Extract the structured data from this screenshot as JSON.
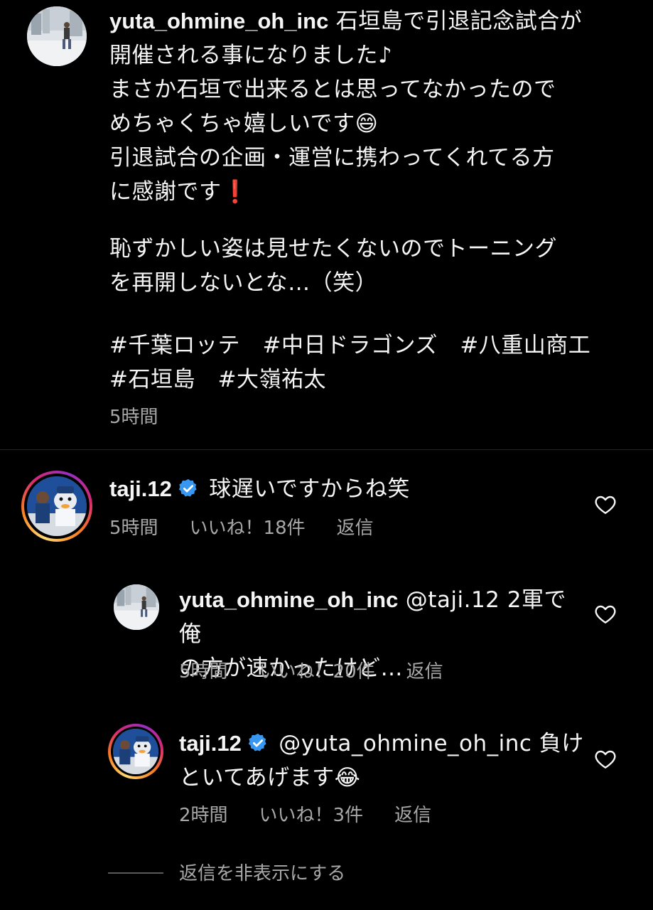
{
  "caption": {
    "username": "yuta_ohmine_oh_inc",
    "line1": "石垣島で引退記念試合が",
    "line2": "開催される事になりました♪",
    "line3": "まさか石垣で出来るとは思ってなかったので",
    "line4": "めちゃくちゃ嬉しいです😄",
    "line5": "引退試合の企画・運営に携わってくれてる方",
    "line6": "に感謝です❗",
    "line7": "恥ずかしい姿は見せたくないのでトーニング",
    "line8": "を再開しないとな…（笑）",
    "hashtags_line1": "#千葉ロッテ　#中日ドラゴンズ　#八重山商工",
    "hashtags_line2": "#石垣島　#大嶺祐太",
    "time": "5時間"
  },
  "comments": [
    {
      "username": "taji.12",
      "text": "球遅いですからね笑",
      "time": "5時間",
      "likes": "いいね！18件",
      "reply": "返信"
    }
  ],
  "replies": [
    {
      "username": "yuta_ohmine_oh_inc",
      "text_line1": "@taji.12 2軍で俺",
      "text_line2": "の方が速かったけど…",
      "time": "5時間",
      "likes": "いいね！20件",
      "reply": "返信"
    },
    {
      "username": "taji.12",
      "text_line1": "@yuta_ohmine_oh_inc 負け",
      "text_line2": "といてあげます😂",
      "time": "2時間",
      "likes": "いいね！3件",
      "reply": "返信"
    }
  ],
  "hide_replies": "返信を非表示にする",
  "colors": {
    "background": "#000000",
    "text": "#f5f5f5",
    "secondary": "#a8a8a8",
    "verified": "#3897f0",
    "divider": "#262626"
  }
}
